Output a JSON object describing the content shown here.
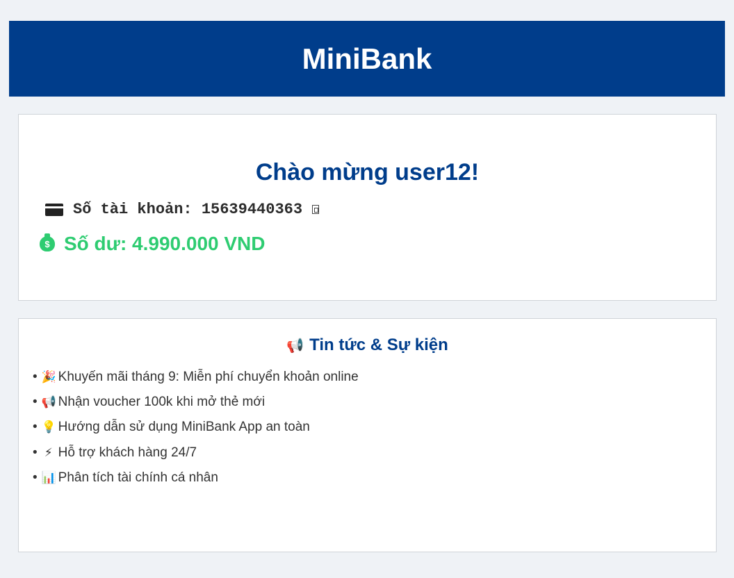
{
  "app": {
    "title": "MiniBank"
  },
  "account": {
    "welcome": "Chào mừng user12!",
    "account_label": "Số tài khoản: 15639440363",
    "balance_label": "Số dư: 4.990.000 VND",
    "balance_color": "#2ecc71"
  },
  "news": {
    "title": "Tin tức & Sự kiện",
    "items": [
      {
        "icon": "party-popper-icon",
        "glyph": "🎉",
        "text": "Khuyến mãi tháng 9: Miễn phí chuyển khoản online"
      },
      {
        "icon": "megaphone-icon",
        "glyph": "📢",
        "text": "Nhận voucher 100k khi mở thẻ mới"
      },
      {
        "icon": "lightbulb-icon",
        "glyph": "💡",
        "text": "Hướng dẫn sử dụng MiniBank App an toàn"
      },
      {
        "icon": "lightning-icon",
        "glyph": "⚡",
        "text": "Hỗ trợ khách hàng 24/7"
      },
      {
        "icon": "bar-chart-icon",
        "glyph": "📊",
        "text": "Phân tích tài chính cá nhân"
      }
    ]
  },
  "colors": {
    "brand": "#003d8b",
    "background": "#eff2f6",
    "success": "#2ecc71"
  }
}
